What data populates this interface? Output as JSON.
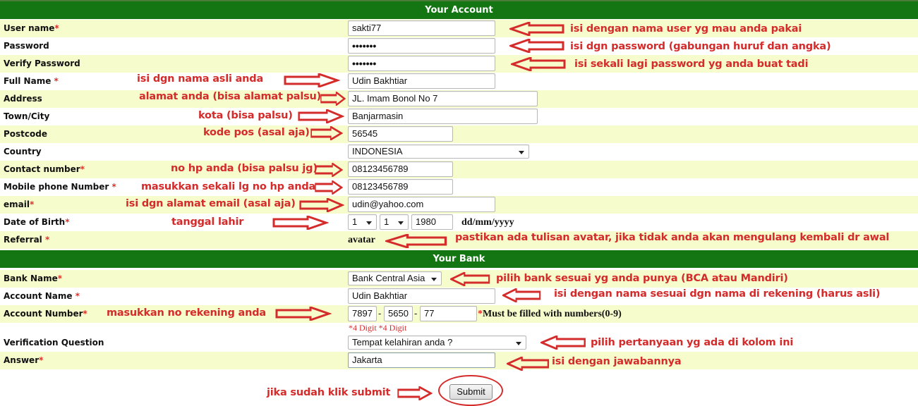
{
  "account_section": {
    "title": "Your Account",
    "fields": {
      "username": {
        "label": "User name",
        "required": "*",
        "value": "sakti77"
      },
      "password": {
        "label": "Password",
        "value": "•••••••"
      },
      "verify_password": {
        "label": "Verify Password",
        "value": "•••••••"
      },
      "full_name": {
        "label": "Full Name ",
        "required": "*",
        "value": "Udin Bakhtiar"
      },
      "address": {
        "label": "Address",
        "value": "JL. Imam Bonol No 7"
      },
      "town": {
        "label": "Town/City",
        "value": "Banjarmasin"
      },
      "postcode": {
        "label": "Postcode",
        "value": "56545"
      },
      "country": {
        "label": "Country",
        "value": "INDONESIA"
      },
      "contact": {
        "label": "Contact number",
        "required": "*",
        "value": "08123456789"
      },
      "mobile": {
        "label": "Mobile phone Number ",
        "required": "*",
        "value": "08123456789"
      },
      "email": {
        "label": "email",
        "required": "*",
        "value": "udin@yahoo.com"
      },
      "dob": {
        "label": "Date of Birth",
        "required": "*",
        "day": "1",
        "month": "1",
        "year": "1980",
        "format_hint": "dd/mm/yyyy"
      },
      "referral": {
        "label": "Referral ",
        "required": "*",
        "value": "avatar"
      }
    }
  },
  "bank_section": {
    "title": "Your Bank",
    "fields": {
      "bank_name": {
        "label": "Bank Name",
        "required": "*",
        "value": "Bank Central Asia"
      },
      "account_name": {
        "label": "Account Name ",
        "required": "*",
        "value": "Udin Bakhtiar"
      },
      "account_number": {
        "label": "Account Number",
        "required": "*",
        "part1": "7897",
        "part2": "5650",
        "part3": "77",
        "separator": "-",
        "hint_req": "*",
        "hint": "Must be filled with numbers(0-9)",
        "digit_hint": "*4 Digit *4 Digit"
      },
      "verification_question": {
        "label": "Verification Question",
        "value": "Tempat kelahiran anda ?"
      },
      "answer": {
        "label": "Answer",
        "required": "*",
        "value": "Jakarta"
      }
    }
  },
  "submit_label": "Submit",
  "annotations": {
    "username": "isi dengan nama user yg mau anda pakai",
    "password": "isi dgn password (gabungan huruf dan angka)",
    "verify_password": "isi sekali lagi password yg anda buat tadi",
    "full_name": "isi dgn nama asli anda",
    "address": "alamat anda (bisa alamat palsu)",
    "town": "kota (bisa palsu)",
    "postcode": "kode pos (asal aja)",
    "contact": "no hp anda (bisa palsu jg)",
    "mobile": "masukkan sekali lg no hp anda",
    "email": "isi dgn alamat email (asal aja)",
    "dob": "tanggal lahir",
    "referral": "pastikan ada tulisan avatar, jika tidak anda akan mengulang kembali dr awal",
    "bank_name": "pilih bank sesuai yg anda punya (BCA atau Mandiri)",
    "account_name": "isi dengan nama sesuai dgn nama di rekening (harus asli)",
    "account_number": "masukkan no rekening anda",
    "verification_question": "pilih pertanyaan yg ada di kolom ini",
    "answer": "isi dengan jawabannya",
    "submit": "jika sudah klik submit"
  },
  "colors": {
    "header_green": "#137612",
    "row_alt": "#f6fccb",
    "annotation_red": "#d42b2b",
    "required_red": "#e0302a"
  }
}
